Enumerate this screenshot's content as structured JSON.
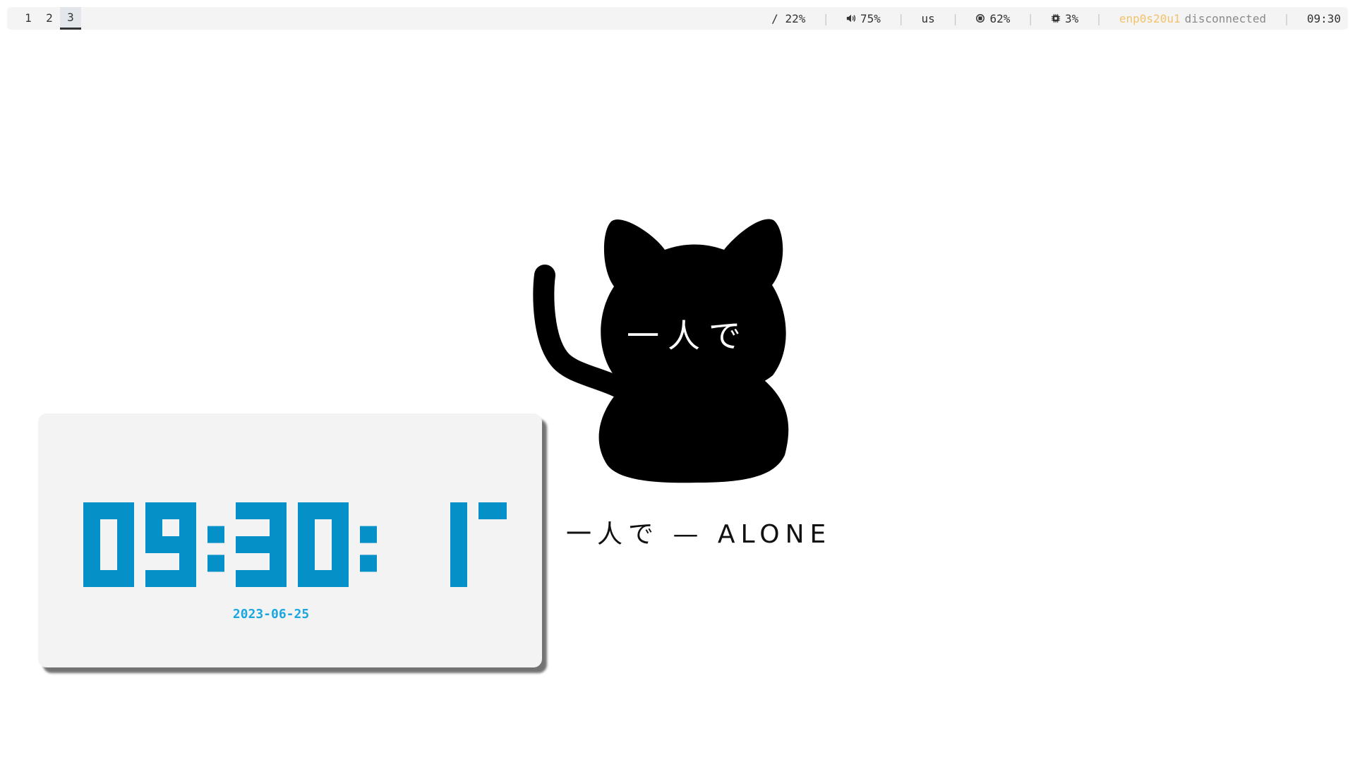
{
  "topbar": {
    "workspaces": [
      "1",
      "2",
      "3"
    ],
    "active_workspace": "3",
    "disk": "/ 22%",
    "volume": "75%",
    "keyboard_layout": "us",
    "memory": "62%",
    "cpu": "3%",
    "network_interface": "enp0s20u1",
    "network_state": "disconnected",
    "time": "09:30",
    "separator": "|",
    "icons": {
      "volume": "speaker-icon",
      "memory": "memory-icon",
      "cpu": "cpu-icon"
    },
    "colors": {
      "bar_bg": "#f4f4f4",
      "text": "#333333",
      "interface": "#f2c26b",
      "separator": "#c9c9c9"
    }
  },
  "wallpaper": {
    "cat_face_text": "一人で",
    "tagline": "一人で — ALONE",
    "colors": {
      "cat": "#000000",
      "face_text": "#ffffff"
    }
  },
  "clock_widget": {
    "time": "09:30: 17",
    "date": "2023-06-25",
    "colors": {
      "digits": "#0590c8",
      "date": "#1aa6e0",
      "card_bg": "#f3f3f3"
    }
  }
}
